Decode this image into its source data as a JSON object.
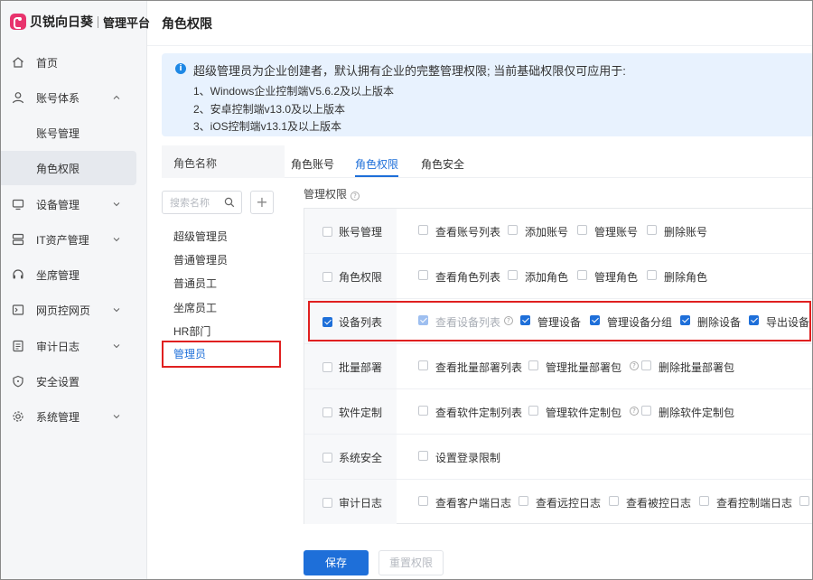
{
  "brand": {
    "name": "贝锐向日葵",
    "subtitle": "管理平台"
  },
  "header": {
    "title": "角色权限"
  },
  "sidebar": {
    "items": [
      {
        "label": "首页",
        "icon": "home-icon"
      },
      {
        "label": "账号体系",
        "icon": "user-icon",
        "expanded": true
      },
      {
        "label": "账号管理",
        "sub": true
      },
      {
        "label": "角色权限",
        "sub": true,
        "active": true
      },
      {
        "label": "设备管理",
        "icon": "monitor-icon"
      },
      {
        "label": "IT资产管理",
        "icon": "server-icon"
      },
      {
        "label": "坐席管理",
        "icon": "headset-icon"
      },
      {
        "label": "网页控网页",
        "icon": "web-icon"
      },
      {
        "label": "审计日志",
        "icon": "log-icon"
      },
      {
        "label": "安全设置",
        "icon": "shield-icon"
      },
      {
        "label": "系统管理",
        "icon": "gear-icon"
      }
    ]
  },
  "notice": {
    "main": "超级管理员为企业创建者，默认拥有企业的完整管理权限; 当前基础权限仅可应用于:",
    "lines": [
      "1、Windows企业控制端V5.6.2及以上版本",
      "2、安卓控制端v13.0及以上版本",
      "3、iOS控制端v13.1及以上版本"
    ]
  },
  "roles": {
    "header": "角色名称",
    "search_placeholder": "搜索名称",
    "add_label": "+",
    "items": [
      "超级管理员",
      "普通管理员",
      "普通员工",
      "坐席员工",
      "HR部门",
      "管理员"
    ],
    "selected": "管理员"
  },
  "tabs": [
    {
      "label": "角色账号"
    },
    {
      "label": "角色权限",
      "active": true
    },
    {
      "label": "角色安全"
    }
  ],
  "permissions": {
    "title": "管理权限",
    "rows": [
      {
        "category": "账号管理",
        "checked": false,
        "options": [
          {
            "label": "查看账号列表",
            "checked": false
          },
          {
            "label": "添加账号",
            "checked": false
          },
          {
            "label": "管理账号",
            "checked": false
          },
          {
            "label": "删除账号",
            "checked": false
          }
        ]
      },
      {
        "category": "角色权限",
        "checked": false,
        "options": [
          {
            "label": "查看角色列表",
            "checked": false
          },
          {
            "label": "添加角色",
            "checked": false
          },
          {
            "label": "管理角色",
            "checked": false
          },
          {
            "label": "删除角色",
            "checked": false
          }
        ]
      },
      {
        "category": "设备列表",
        "checked": true,
        "options": [
          {
            "label": "查看设备列表",
            "checked": true,
            "disabled": true
          },
          {
            "label": "管理设备",
            "checked": true
          },
          {
            "label": "管理设备分组",
            "checked": true
          },
          {
            "label": "删除设备",
            "checked": true
          },
          {
            "label": "导出设备",
            "checked": true
          }
        ]
      },
      {
        "category": "批量部署",
        "checked": false,
        "options": [
          {
            "label": "查看批量部署列表",
            "checked": false
          },
          {
            "label": "管理批量部署包",
            "checked": false
          },
          {
            "label": "删除批量部署包",
            "checked": false
          }
        ]
      },
      {
        "category": "软件定制",
        "checked": false,
        "options": [
          {
            "label": "查看软件定制列表",
            "checked": false
          },
          {
            "label": "管理软件定制包",
            "checked": false
          },
          {
            "label": "删除软件定制包",
            "checked": false
          }
        ]
      },
      {
        "category": "系统安全",
        "checked": false,
        "options": [
          {
            "label": "设置登录限制",
            "checked": false
          }
        ]
      },
      {
        "category": "审计日志",
        "checked": false,
        "options": [
          {
            "label": "查看客户端日志",
            "checked": false
          },
          {
            "label": "查看远控日志",
            "checked": false
          },
          {
            "label": "查看被控日志",
            "checked": false
          },
          {
            "label": "查看控制端日志",
            "checked": false
          }
        ]
      }
    ]
  },
  "buttons": {
    "save": "保存",
    "reset": "重置权限"
  },
  "colors": {
    "accent": "#1e6fd9",
    "highlight": "#e02020",
    "brand": "#e8336d"
  }
}
